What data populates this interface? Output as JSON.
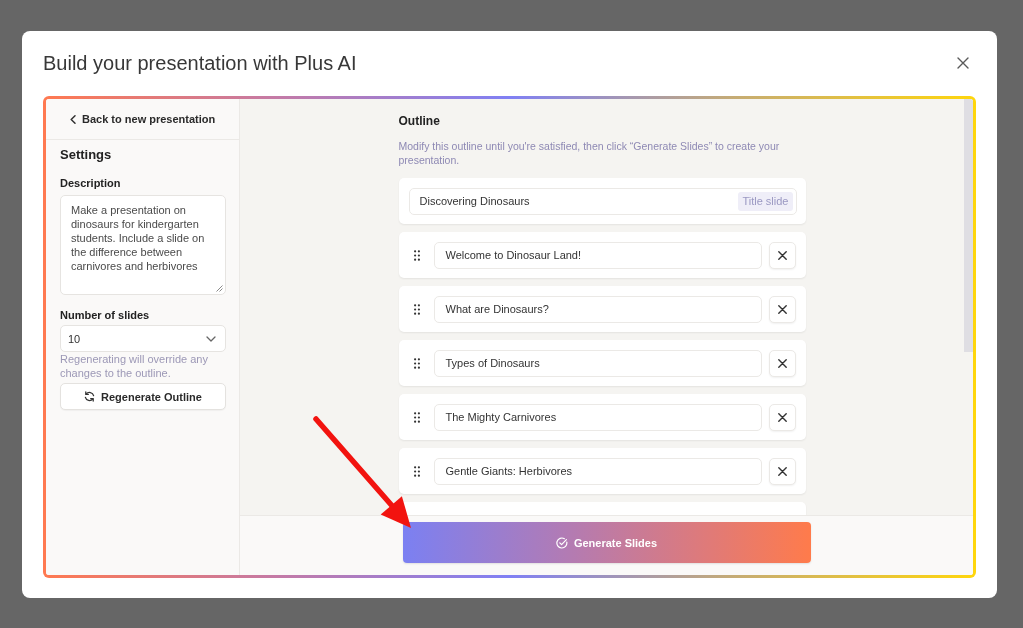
{
  "dialog": {
    "title": "Build your presentation with Plus AI"
  },
  "sidebar": {
    "back_link": "Back to new presentation",
    "heading": "Settings",
    "description": {
      "label": "Description",
      "value": "Make a presentation on dinosaurs for kindergarten students. Include a slide on the difference between carnivores and herbivores"
    },
    "slide_count": {
      "label": "Number of slides",
      "value": "10",
      "hint": "Regenerating will override any changes to the outline."
    },
    "regenerate_button": "Regenerate Outline"
  },
  "outline": {
    "heading": "Outline",
    "instructions": "Modify this outline until you're satisfied, then click “Generate Slides” to create your presentation.",
    "slides": [
      {
        "kind": "title",
        "value": "Discovering Dinosaurs",
        "badge": "Title slide"
      },
      {
        "kind": "content",
        "value": "Welcome to Dinosaur Land!"
      },
      {
        "kind": "content",
        "value": "What are Dinosaurs?"
      },
      {
        "kind": "content",
        "value": "Types of Dinosaurs"
      },
      {
        "kind": "content",
        "value": "The Mighty Carnivores"
      },
      {
        "kind": "content",
        "value": "Gentle Giants: Herbivores"
      }
    ],
    "generate_button": "Generate Slides"
  }
}
